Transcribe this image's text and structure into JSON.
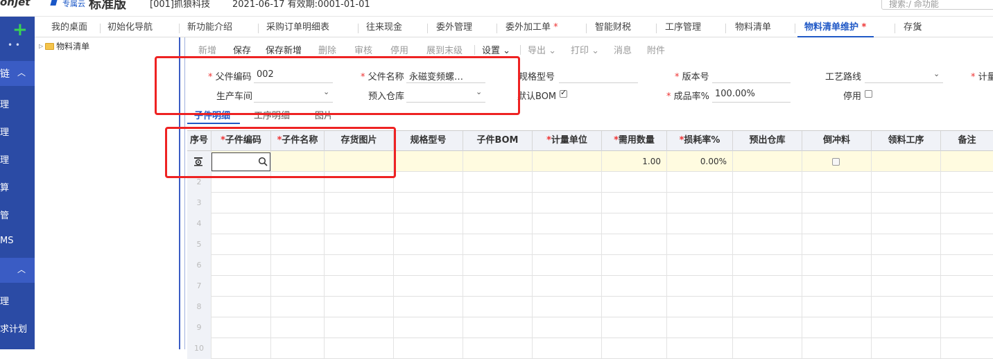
{
  "header": {
    "brand": "onjet",
    "edition_small": "专属云",
    "edition_name": "标准版",
    "account": "[001]抓狼科技",
    "dates": "2021-06-17   有效期:0001-01-01",
    "search_placeholder": "搜索:/ 命功能"
  },
  "sidebar": {
    "dots": "•  •",
    "group1": "链",
    "group2": "",
    "items": [
      "理",
      "理",
      "理",
      "算",
      "管",
      "MS",
      "理",
      "求计划"
    ]
  },
  "tree": {
    "root": "物料清单"
  },
  "tabs": [
    {
      "label": "我的桌面",
      "required": false
    },
    {
      "label": "初始化导航",
      "required": false
    },
    {
      "label": "新功能介绍",
      "required": false
    },
    {
      "label": "采购订单明细表",
      "required": false
    },
    {
      "label": "往来现金",
      "required": false
    },
    {
      "label": "委外管理",
      "required": false
    },
    {
      "label": "委外加工单",
      "required": true
    },
    {
      "label": "智能财税",
      "required": false
    },
    {
      "label": "工序管理",
      "required": false
    },
    {
      "label": "物料清单",
      "required": false
    },
    {
      "label": "物料清单维护",
      "required": true
    },
    {
      "label": "存货",
      "required": false
    }
  ],
  "tab_close": "×",
  "toolbar": {
    "add": "新增",
    "save": "保存",
    "save_new": "保存新增",
    "delete": "删除",
    "audit": "审核",
    "disable": "停用",
    "expand": "展到末级",
    "settings": "设置",
    "export": "导出",
    "print": "打印",
    "message": "消息",
    "attachment": "附件"
  },
  "form": {
    "parent_code_label": "父件编码",
    "parent_code_value": "002",
    "parent_name_label": "父件名称",
    "parent_name_value": "永磁变频螺…",
    "spec_label": "规格型号",
    "version_label": "版本号",
    "route_label": "工艺路线",
    "unit_label": "计量",
    "workshop_label": "生产车间",
    "warehouse_label": "预入仓库",
    "default_bom_label": "默认BOM",
    "yield_label": "成品率%",
    "yield_value": "100.00%",
    "disabled_label": "停用"
  },
  "subtabs": [
    "子件明细",
    "工序明细",
    "图片"
  ],
  "grid": {
    "columns": [
      {
        "label": "序号",
        "required": false
      },
      {
        "label": "子件编码",
        "required": true
      },
      {
        "label": "子件名称",
        "required": true
      },
      {
        "label": "存货图片",
        "required": false
      },
      {
        "label": "规格型号",
        "required": false
      },
      {
        "label": "子件BOM",
        "required": false
      },
      {
        "label": "计量单位",
        "required": true
      },
      {
        "label": "需用数量",
        "required": true
      },
      {
        "label": "损耗率%",
        "required": true
      },
      {
        "label": "预出仓库",
        "required": false
      },
      {
        "label": "倒冲料",
        "required": false
      },
      {
        "label": "领料工序",
        "required": false
      },
      {
        "label": "备注",
        "required": false
      }
    ],
    "first_row": {
      "qty": "1.00",
      "loss_rate": "0.00%"
    },
    "row_numbers": [
      "2",
      "3",
      "4",
      "5",
      "6",
      "7",
      "8",
      "9",
      "10"
    ]
  },
  "colors": {
    "sidebar": "#2b4ba5",
    "accent": "#1f58c6",
    "required": "#e33",
    "highlight": "#e22",
    "row_highlight": "#fffbe0"
  }
}
